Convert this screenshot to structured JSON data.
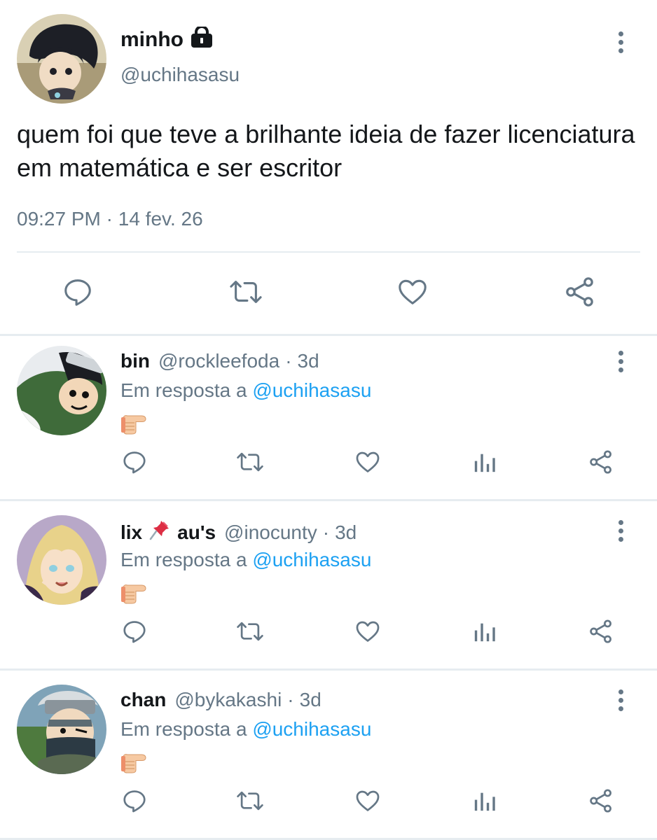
{
  "main_tweet": {
    "author_name": "minho",
    "handle": "@uchihasasu",
    "text": "quem foi que teve a brilhante ideia de fazer licenciatura em matemática e ser escritor",
    "time": "09:27 PM",
    "date": "14 fev. 26",
    "separator": "·"
  },
  "replies": [
    {
      "name": "bin",
      "handle": "@rockleefoda",
      "time": "3d",
      "reply_prefix": "Em resposta a",
      "reply_to": "@uchihasasu",
      "avatar_color": "#3f6b3a"
    },
    {
      "name": "lix",
      "name_suffix": "au's",
      "name_emoji": "pushpin",
      "handle": "@inocunty",
      "time": "3d",
      "reply_prefix": "Em resposta a",
      "reply_to": "@uchihasasu",
      "avatar_color": "#e8d28a"
    },
    {
      "name": "chan",
      "handle": "@bykakashi",
      "time": "3d",
      "reply_prefix": "Em resposta a",
      "reply_to": "@uchihasasu",
      "avatar_color": "#5c6b73"
    }
  ],
  "dot": "·",
  "icons": {
    "lock": "lock-icon",
    "more": "more-vertical-icon",
    "reply": "reply-icon",
    "retweet": "retweet-icon",
    "like": "heart-icon",
    "analytics": "analytics-icon",
    "share": "share-icon",
    "pointing_hand": "pointing-hand-emoji"
  },
  "colors": {
    "text": "#14171a",
    "secondary": "#657786",
    "link": "#1da1f2",
    "divider": "#e6ecf0"
  }
}
